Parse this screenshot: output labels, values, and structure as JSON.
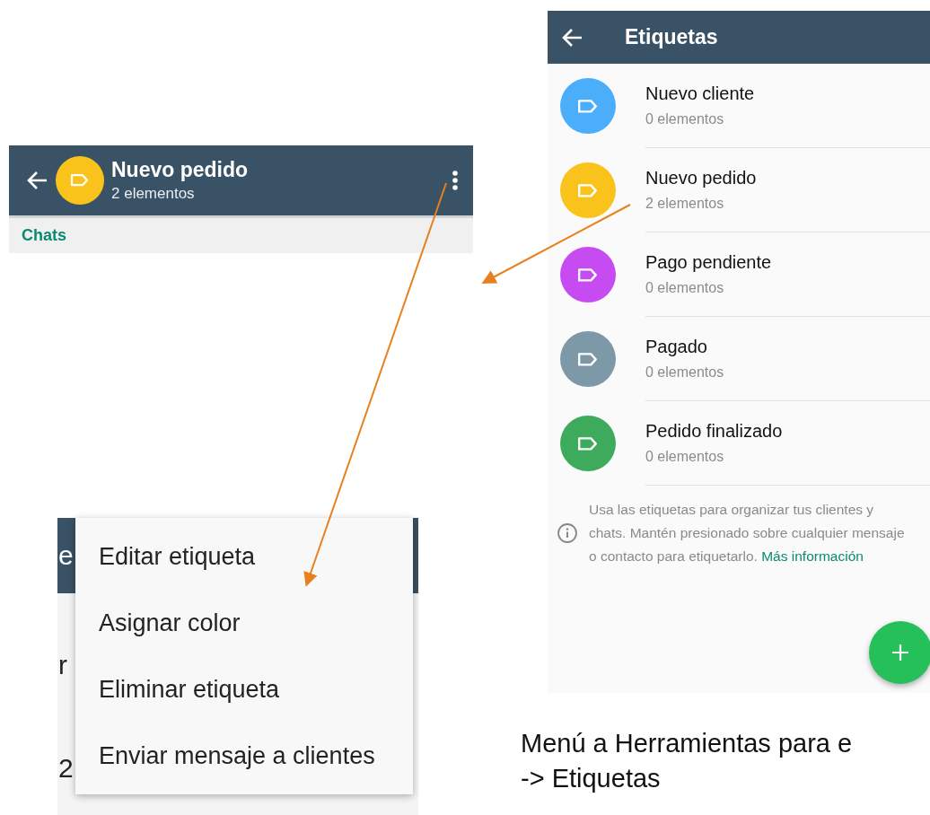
{
  "group_header": {
    "title": "Nuevo pedido",
    "subtitle": "2 elementos",
    "tab": "Chats"
  },
  "labels_screen": {
    "title": "Etiquetas",
    "labels": [
      {
        "name": "Nuevo cliente",
        "count": "0 elementos",
        "color": "#4aaefb"
      },
      {
        "name": "Nuevo pedido",
        "count": "2 elementos",
        "color": "#f9c31c"
      },
      {
        "name": "Pago pendiente",
        "count": "0 elementos",
        "color": "#c64cf2"
      },
      {
        "name": "Pagado",
        "count": "0 elementos",
        "color": "#7d98a7"
      },
      {
        "name": "Pedido finalizado",
        "count": "0 elementos",
        "color": "#3eaa5c"
      }
    ],
    "info": "Usa las etiquetas para organizar tus clientes y chats. Mantén presionado sobre cualquier mensaje o contacto para etiquetarlo.",
    "info_link": "Más información"
  },
  "menu": {
    "behind": [
      "e",
      "r",
      "2"
    ],
    "items": [
      "Editar etiqueta",
      "Asignar color",
      "Eliminar etiqueta",
      "Enviar mensaje a clientes"
    ]
  },
  "caption": [
    "Menú a Herramientas para e",
    "-> Etiquetas"
  ]
}
